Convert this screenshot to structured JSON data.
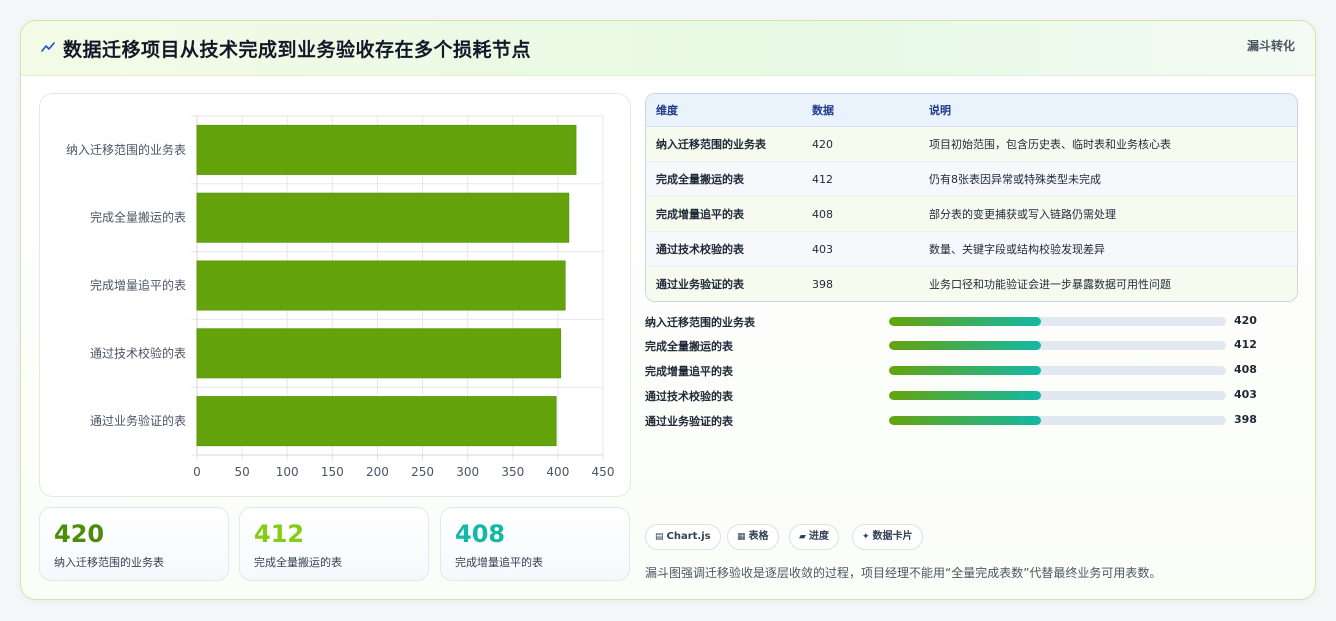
{
  "header": {
    "title": "数据迁移项目从技术完成到业务验收存在多个损耗节点",
    "tag": "漏斗转化",
    "icon": "zigzag-line-icon"
  },
  "chart_data": {
    "type": "bar",
    "orientation": "horizontal",
    "categories": [
      "纳入迁移范围的业务表",
      "完成全量搬运的表",
      "完成增量追平的表",
      "通过技术校验的表",
      "通过业务验证的表"
    ],
    "values": [
      420,
      412,
      408,
      403,
      398
    ],
    "xlim": [
      0,
      450
    ],
    "x_ticks": [
      0,
      50,
      100,
      150,
      200,
      250,
      300,
      350,
      400,
      450
    ],
    "grid": true,
    "legend": "none",
    "bar_color": "#65a30d",
    "title": "",
    "xlabel": "",
    "ylabel": ""
  },
  "stats": [
    {
      "value": "420",
      "label": "纳入迁移范围的业务表",
      "color": "#4d8c0a"
    },
    {
      "value": "412",
      "label": "完成全量搬运的表",
      "color": "#84cc16"
    },
    {
      "value": "408",
      "label": "完成增量追平的表",
      "color": "#14b8a6"
    }
  ],
  "table": {
    "headers": [
      "维度",
      "数据",
      "说明"
    ],
    "rows": [
      {
        "dim": "纳入迁移范围的业务表",
        "value": "420",
        "desc": "项目初始范围，包含历史表、临时表和业务核心表"
      },
      {
        "dim": "完成全量搬运的表",
        "value": "412",
        "desc": "仍有8张表因异常或特殊类型未完成"
      },
      {
        "dim": "完成增量追平的表",
        "value": "408",
        "desc": "部分表的变更捕获或写入链路仍需处理"
      },
      {
        "dim": "通过技术校验的表",
        "value": "403",
        "desc": "数量、关键字段或结构校验发现差异"
      },
      {
        "dim": "通过业务验证的表",
        "value": "398",
        "desc": "业务口径和功能验证会进一步暴露数据可用性问题"
      }
    ]
  },
  "progress": [
    {
      "label": "纳入迁移范围的业务表",
      "value": "420",
      "fraction": 0.45
    },
    {
      "label": "完成全量搬运的表",
      "value": "412",
      "fraction": 0.45
    },
    {
      "label": "完成增量追平的表",
      "value": "408",
      "fraction": 0.45
    },
    {
      "label": "通过技术校验的表",
      "value": "403",
      "fraction": 0.45
    },
    {
      "label": "通过业务验证的表",
      "value": "398",
      "fraction": 0.45
    }
  ],
  "chips": [
    {
      "icon": "▤",
      "icon_name": "chart-icon",
      "label": "Chart.js"
    },
    {
      "icon": "▦",
      "icon_name": "table-icon",
      "label": "表格"
    },
    {
      "icon": "▰",
      "icon_name": "progress-icon",
      "label": "进度"
    },
    {
      "icon": "✦",
      "icon_name": "sparkle-icon",
      "label": "数据卡片"
    }
  ],
  "note": "漏斗图强调迁移验收是逐层收敛的过程，项目经理不能用“全量完成表数”代替最终业务可用表数。"
}
